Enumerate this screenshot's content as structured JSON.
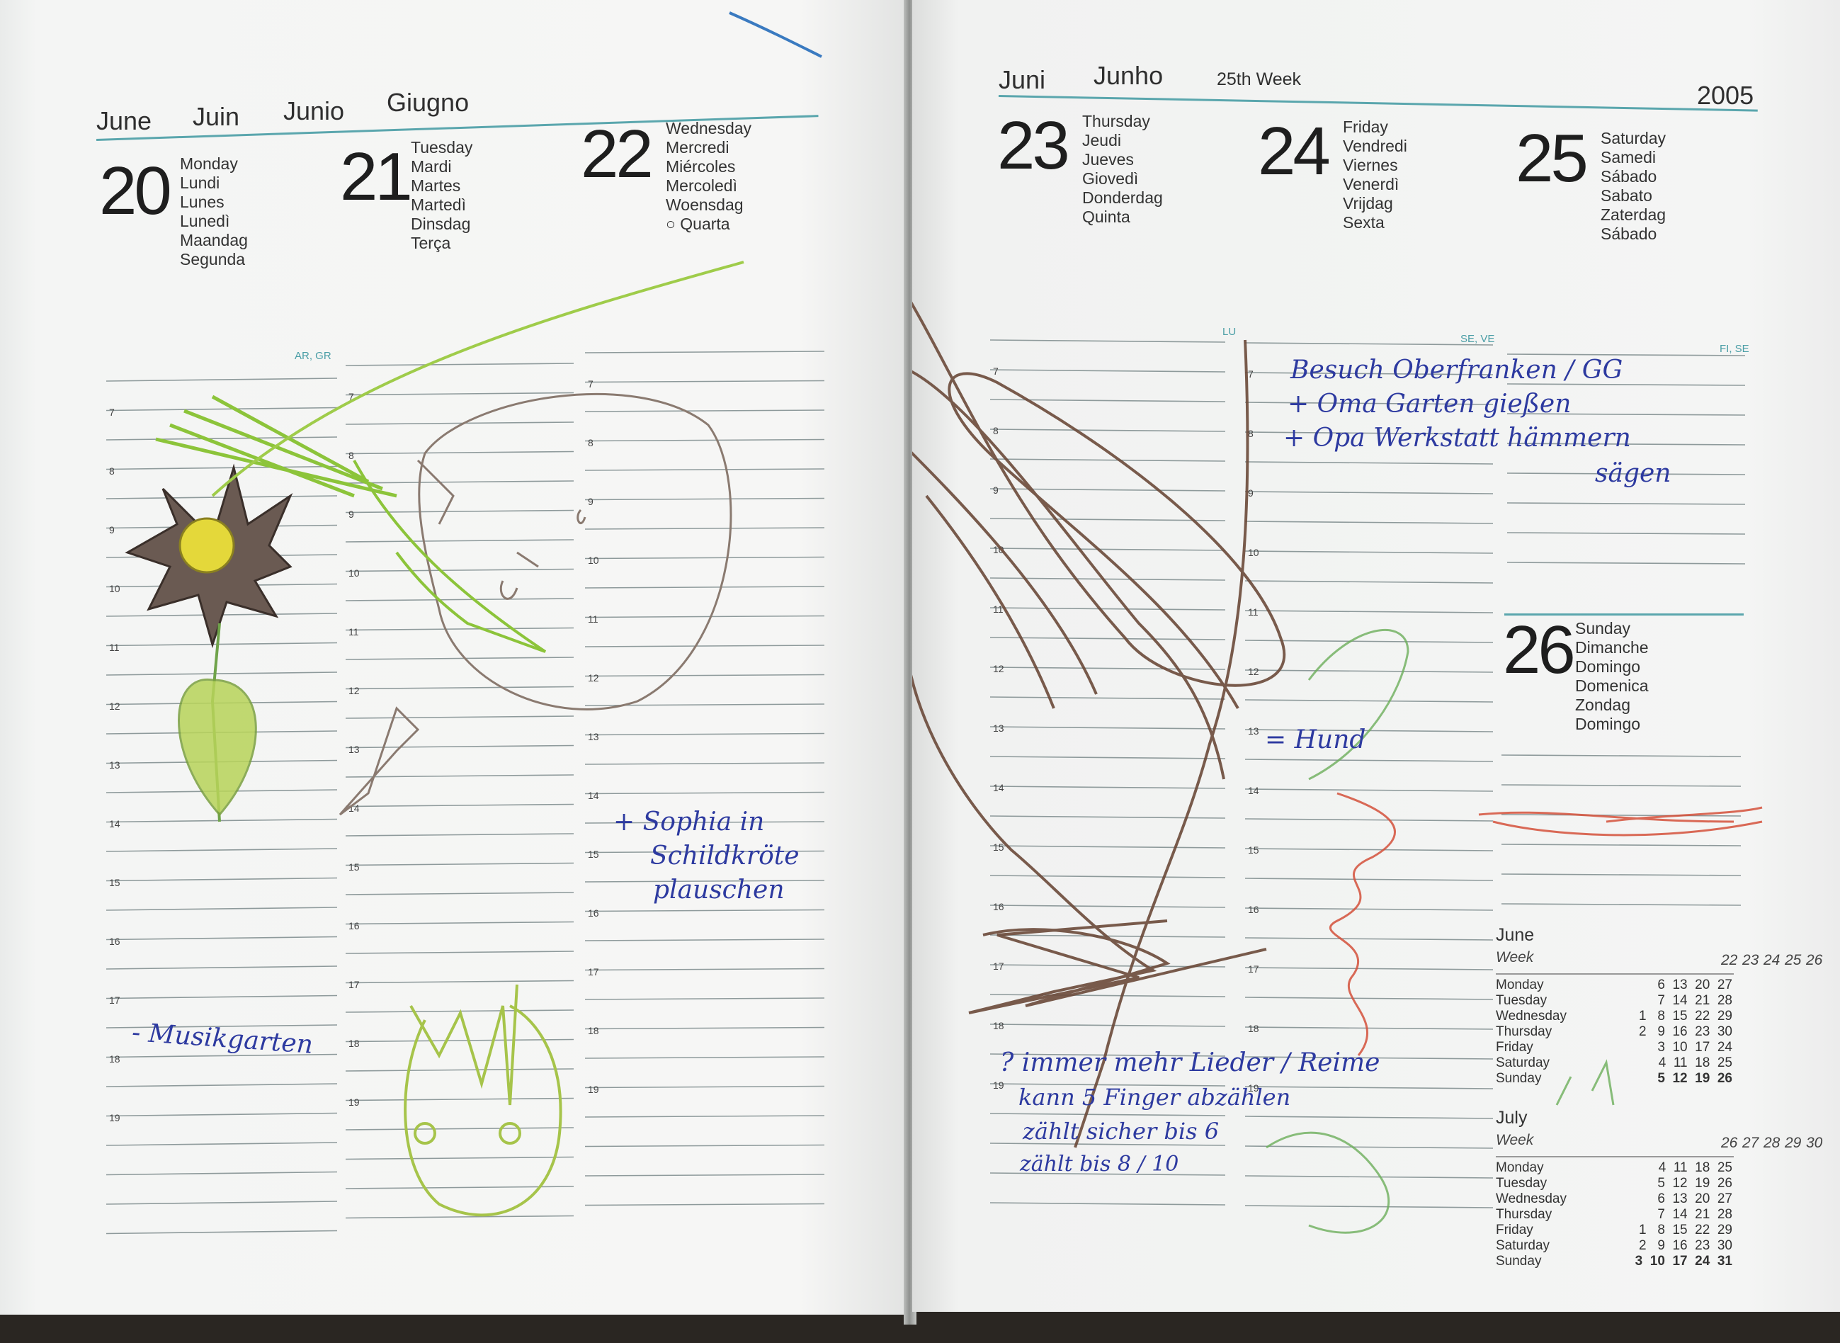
{
  "left": {
    "months": [
      "June",
      "Juin",
      "Junio",
      "Giugno"
    ],
    "days": [
      {
        "num": "20",
        "names": "Monday\nLundi\nLunes\nLunedì\nMaandag\nSegunda"
      },
      {
        "num": "21",
        "names": "Tuesday\nMardi\nMartes\nMartedì\nDinsdag\nTerça"
      },
      {
        "num": "22",
        "names": "Wednesday\nMercredi\nMiércoles\nMercoledì\nWoensdag\n○ Quarta"
      }
    ],
    "nameday": "AR, GR",
    "hours": [
      "7",
      "8",
      "9",
      "10",
      "11",
      "12",
      "13",
      "14",
      "15",
      "16",
      "17",
      "18",
      "19"
    ]
  },
  "right": {
    "months": [
      "Juni",
      "Junho"
    ],
    "week": "25th Week",
    "year": "2005",
    "days": [
      {
        "num": "23",
        "names": "Thursday\nJeudi\nJueves\nGiovedì\nDonderdag\nQuinta"
      },
      {
        "num": "24",
        "names": "Friday\nVendredi\nViernes\nVenerdì\nVrijdag\nSexta"
      },
      {
        "num": "25",
        "names": "Saturday\nSamedi\nSábado\nSabato\nZaterdag\nSábado"
      },
      {
        "num": "26",
        "names": "Sunday\nDimanche\nDomingo\nDomenica\nZondag\nDomingo"
      }
    ],
    "namedays": [
      "LU",
      "SE, VE",
      "FI, SE"
    ],
    "hours": [
      "7",
      "8",
      "9",
      "10",
      "11",
      "12",
      "13",
      "14",
      "15",
      "16",
      "17",
      "18",
      "19"
    ]
  },
  "mini_calendars": [
    {
      "title": "June",
      "week_label": "Week",
      "weeks": [
        "22",
        "23",
        "24",
        "25",
        "26"
      ],
      "rows": [
        {
          "day": "Monday",
          "nums": "6  13  20  27"
        },
        {
          "day": "Tuesday",
          "nums": "7  14  21  28"
        },
        {
          "day": "Wednesday",
          "nums": "1   8  15  22  29"
        },
        {
          "day": "Thursday",
          "nums": "2   9  16  23  30"
        },
        {
          "day": "Friday",
          "nums": "3  10  17  24"
        },
        {
          "day": "Saturday",
          "nums": "4  11  18  25"
        },
        {
          "day": "Sunday",
          "nums": "5  12  19  26"
        }
      ]
    },
    {
      "title": "July",
      "week_label": "Week",
      "weeks": [
        "26",
        "27",
        "28",
        "29",
        "30"
      ],
      "rows": [
        {
          "day": "Monday",
          "nums": "4  11  18  25"
        },
        {
          "day": "Tuesday",
          "nums": "5  12  19  26"
        },
        {
          "day": "Wednesday",
          "nums": "6  13  20  27"
        },
        {
          "day": "Thursday",
          "nums": "7  14  21  28"
        },
        {
          "day": "Friday",
          "nums": "1   8  15  22  29"
        },
        {
          "day": "Saturday",
          "nums": "2   9  16  23  30"
        },
        {
          "day": "Sunday",
          "nums": "3  10  17  24  31"
        }
      ]
    }
  ],
  "handwriting": {
    "musikgarten": "- Musikgarten",
    "sophia": [
      "+ Sophia in",
      "Schildkröte",
      "plauschen"
    ],
    "besuch": [
      "Besuch Oberfranken / GG",
      "+ Oma Garten gießen",
      "+ Opa Werkstatt hämmern",
      "sägen"
    ],
    "hund": "= Hund",
    "notes": [
      "? immer mehr Lieder / Reime",
      "kann 5 Finger abzählen",
      "zählt sicher bis 6",
      "zählt bis 8 / 10"
    ]
  }
}
